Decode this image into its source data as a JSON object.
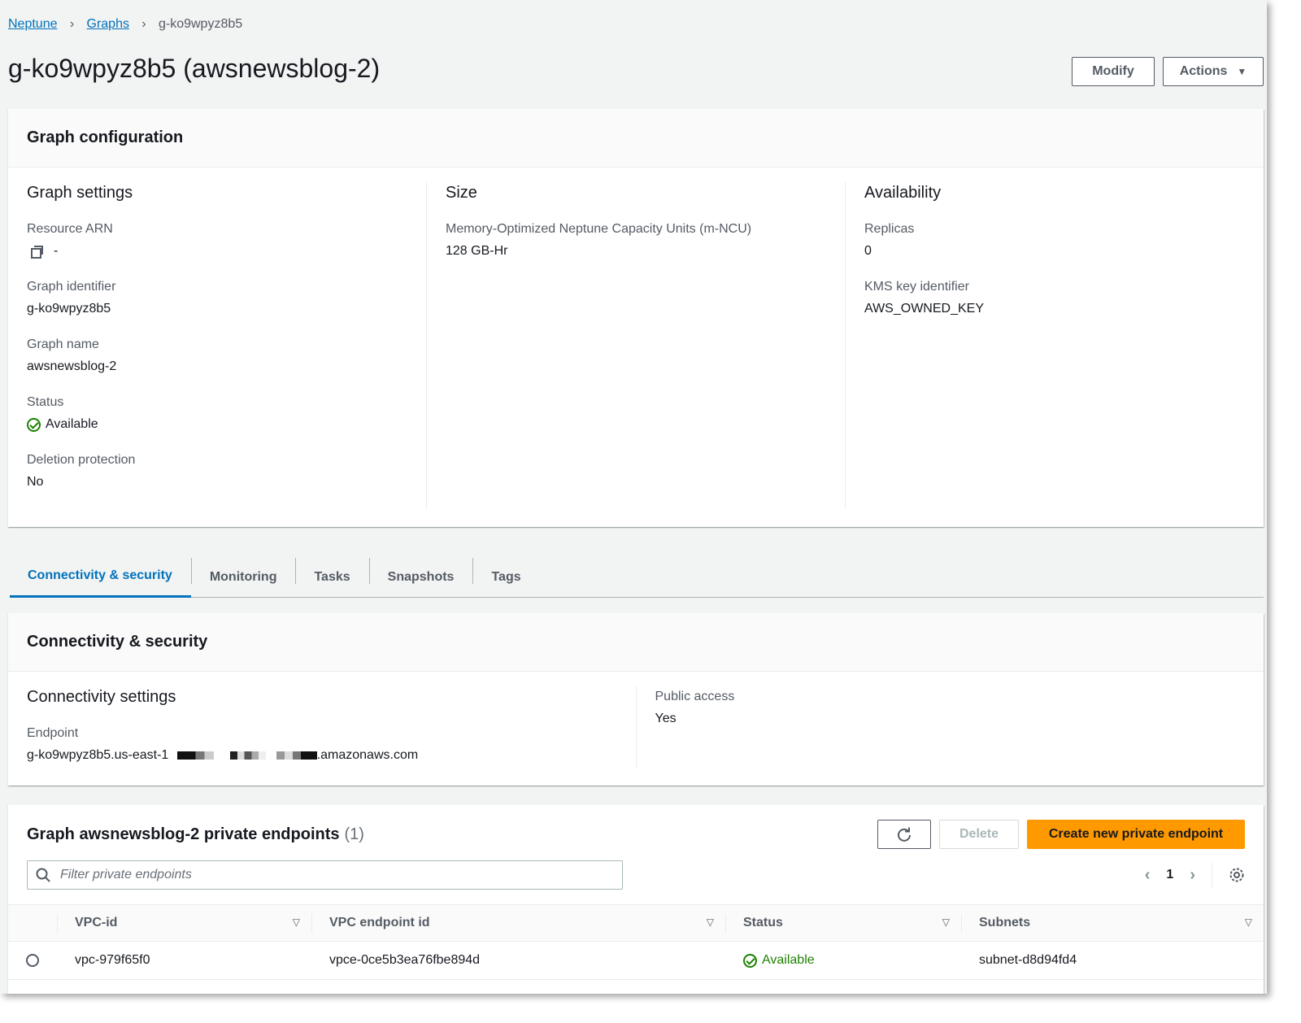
{
  "breadcrumb": {
    "root": "Neptune",
    "section": "Graphs",
    "current": "g-ko9wpyz8b5"
  },
  "page": {
    "title": "g-ko9wpyz8b5 (awsnewsblog-2)"
  },
  "header_actions": {
    "modify": "Modify",
    "actions": "Actions"
  },
  "graph_config": {
    "title": "Graph configuration",
    "settings": {
      "title": "Graph settings",
      "resource_arn_label": "Resource ARN",
      "resource_arn_value": "-",
      "identifier_label": "Graph identifier",
      "identifier_value": "g-ko9wpyz8b5",
      "name_label": "Graph name",
      "name_value": "awsnewsblog-2",
      "status_label": "Status",
      "status_value": "Available",
      "deletion_label": "Deletion protection",
      "deletion_value": "No"
    },
    "size": {
      "title": "Size",
      "capacity_label": "Memory-Optimized Neptune Capacity Units (m-NCU)",
      "capacity_value": "128 GB-Hr"
    },
    "availability": {
      "title": "Availability",
      "replicas_label": "Replicas",
      "replicas_value": "0",
      "kms_label": "KMS key identifier",
      "kms_value": "AWS_OWNED_KEY"
    }
  },
  "tabs": [
    {
      "label": "Connectivity & security"
    },
    {
      "label": "Monitoring"
    },
    {
      "label": "Tasks"
    },
    {
      "label": "Snapshots"
    },
    {
      "label": "Tags"
    }
  ],
  "connectivity": {
    "title": "Connectivity & security",
    "settings_title": "Connectivity settings",
    "endpoint_label": "Endpoint",
    "endpoint_prefix": "g-ko9wpyz8b5.us-east-1",
    "endpoint_suffix": ".amazonaws.com",
    "public_access_label": "Public access",
    "public_access_value": "Yes"
  },
  "private_endpoints": {
    "title": "Graph awsnewsblog-2 private endpoints",
    "count": "(1)",
    "delete_label": "Delete",
    "create_label": "Create new private endpoint",
    "filter_placeholder": "Filter private endpoints",
    "page": "1",
    "columns": [
      "VPC-id",
      "VPC endpoint id",
      "Status",
      "Subnets"
    ],
    "rows": [
      {
        "vpc_id": "vpc-979f65f0",
        "endpoint_id": "vpce-0ce5b3ea76fbe894d",
        "status": "Available",
        "subnets": "subnet-d8d94fd4"
      }
    ]
  },
  "colors": {
    "link": "#0073bb",
    "success": "#1d8102",
    "primary": "#ff9900",
    "background": "#f2f3f3"
  }
}
